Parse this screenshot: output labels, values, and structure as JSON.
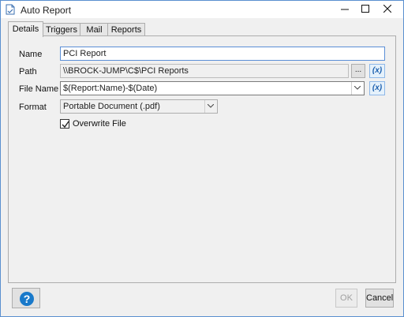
{
  "window": {
    "title": "Auto Report",
    "minimize_glyph": "—",
    "maximize_glyph": "☐",
    "close_glyph": "✕",
    "icon": "report-document-icon"
  },
  "tabs": [
    {
      "label": "Details",
      "active": true
    },
    {
      "label": "Triggers",
      "active": false
    },
    {
      "label": "Mail",
      "active": false
    },
    {
      "label": "Reports",
      "active": false
    }
  ],
  "form": {
    "name_label": "Name",
    "name_value": "PCI Report",
    "path_label": "Path",
    "path_value": "\\\\BROCK-JUMP\\C$\\PCI Reports",
    "browse_label": "...",
    "filename_label": "File Name",
    "filename_value": "$(Report:Name)-$(Date)",
    "format_label": "Format",
    "format_value": "Portable Document (.pdf)",
    "variable_button_label": "(x)",
    "overwrite_label": "Overwrite File",
    "overwrite_checked": true
  },
  "footer": {
    "help_icon": "question-circle-icon",
    "ok_label": "OK",
    "cancel_label": "Cancel"
  },
  "colors": {
    "accent": "#1b5fae",
    "window_border": "#5a8fd0",
    "help_blue": "#1979ca"
  }
}
